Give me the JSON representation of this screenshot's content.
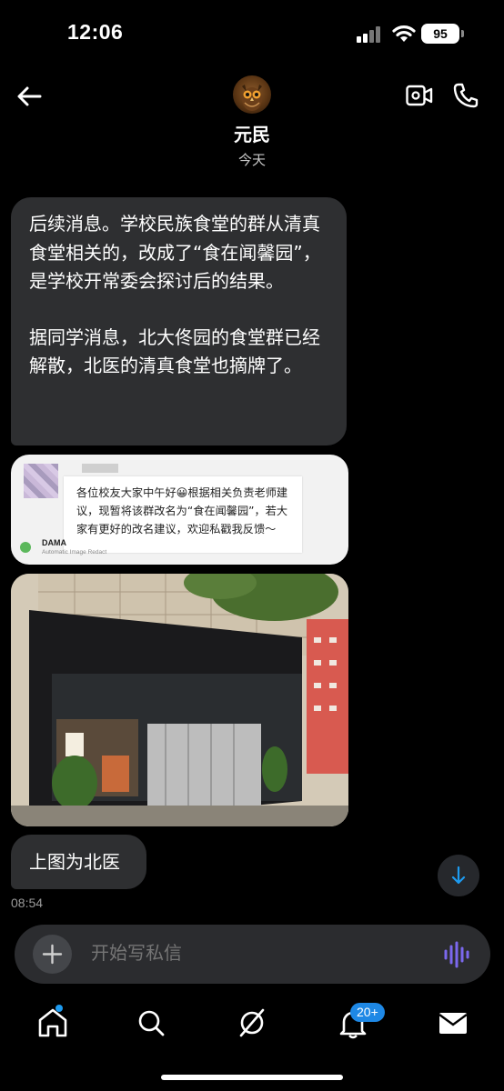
{
  "status_bar": {
    "time": "12:06",
    "battery": "95"
  },
  "header": {
    "contact_name": "元民",
    "day_label": "今天"
  },
  "messages": {
    "first_paragraph": "后续消息。学校民族食堂的群从清真食堂相关的，改成了“食在闻馨园”，是学校开常委会探讨后的结果。",
    "second_paragraph": "据同学消息，北大佟园的食堂群已经解散，北医的清真食堂也摘牌了。",
    "image_notice": {
      "text": "各位校友大家中午好😀根据相关负责老师建议，现暂将该群改名为“食在闻馨园”，若大家有更好的改名建议，欢迎私戳我反馈～",
      "sender": "DAMA",
      "caption": "Automatic Image Redact"
    },
    "last_message": "上图为北医",
    "last_time": "08:54"
  },
  "composer": {
    "placeholder": "开始写私信"
  },
  "tabbar": {
    "notifications_badge": "20+"
  },
  "colors": {
    "bubble": "#2e2f31",
    "accent": "#1d9bf0",
    "voice": "#7b68ee"
  }
}
